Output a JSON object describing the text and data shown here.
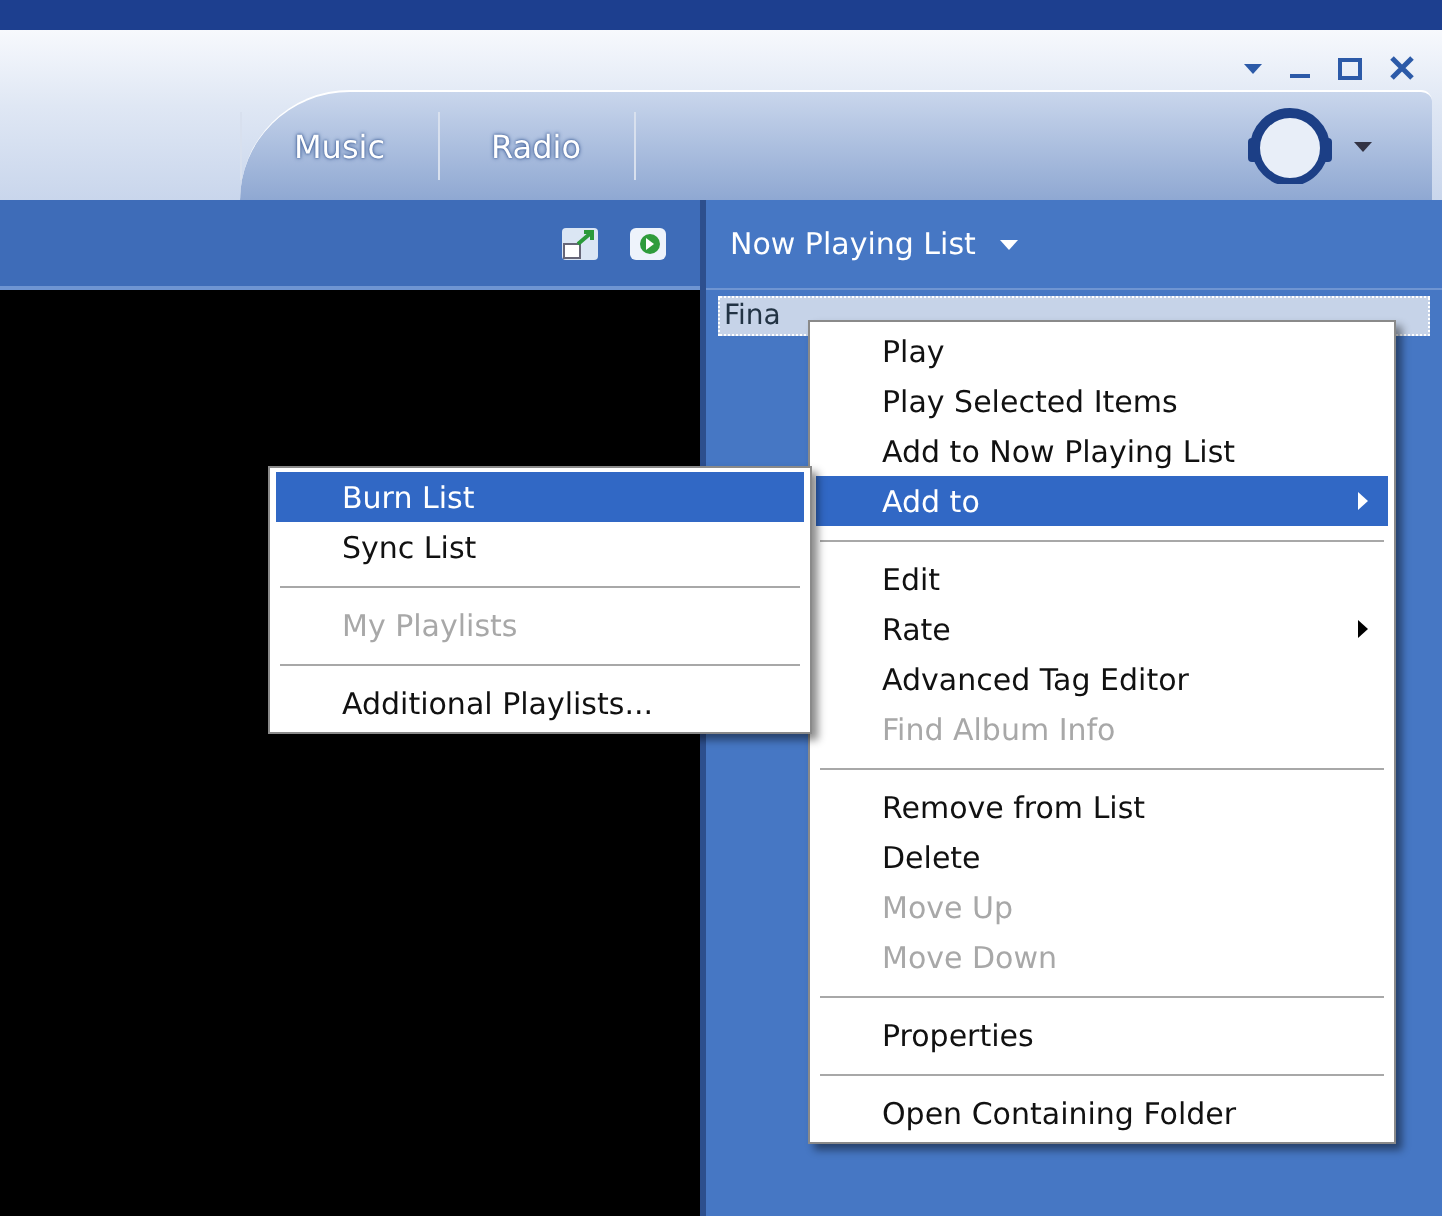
{
  "tabs": [
    {
      "label": "Music"
    },
    {
      "label": "Radio"
    }
  ],
  "now_playing": {
    "title": "Now Playing List",
    "rows": [
      {
        "title": "Fina"
      }
    ]
  },
  "context_menu": {
    "items": [
      {
        "kind": "item",
        "label": "Play",
        "disabled": false,
        "selected": false,
        "submenu": false
      },
      {
        "kind": "item",
        "label": "Play Selected Items",
        "disabled": false,
        "selected": false,
        "submenu": false
      },
      {
        "kind": "item",
        "label": "Add to Now Playing List",
        "disabled": false,
        "selected": false,
        "submenu": false
      },
      {
        "kind": "item",
        "label": "Add to",
        "disabled": false,
        "selected": true,
        "submenu": true
      },
      {
        "kind": "separator"
      },
      {
        "kind": "item",
        "label": "Edit",
        "disabled": false,
        "selected": false,
        "submenu": false
      },
      {
        "kind": "item",
        "label": "Rate",
        "disabled": false,
        "selected": false,
        "submenu": true
      },
      {
        "kind": "item",
        "label": "Advanced Tag Editor",
        "disabled": false,
        "selected": false,
        "submenu": false
      },
      {
        "kind": "item",
        "label": "Find Album Info",
        "disabled": true,
        "selected": false,
        "submenu": false
      },
      {
        "kind": "separator"
      },
      {
        "kind": "item",
        "label": "Remove from List",
        "disabled": false,
        "selected": false,
        "submenu": false
      },
      {
        "kind": "item",
        "label": "Delete",
        "disabled": false,
        "selected": false,
        "submenu": false
      },
      {
        "kind": "item",
        "label": "Move Up",
        "disabled": true,
        "selected": false,
        "submenu": false
      },
      {
        "kind": "item",
        "label": "Move Down",
        "disabled": true,
        "selected": false,
        "submenu": false
      },
      {
        "kind": "separator"
      },
      {
        "kind": "item",
        "label": "Properties",
        "disabled": false,
        "selected": false,
        "submenu": false
      },
      {
        "kind": "separator"
      },
      {
        "kind": "item",
        "label": "Open Containing Folder",
        "disabled": false,
        "selected": false,
        "submenu": false
      }
    ]
  },
  "submenu": {
    "items": [
      {
        "kind": "item",
        "label": "Burn List",
        "disabled": false,
        "selected": true,
        "submenu": false
      },
      {
        "kind": "item",
        "label": "Sync List",
        "disabled": false,
        "selected": false,
        "submenu": false
      },
      {
        "kind": "separator"
      },
      {
        "kind": "item",
        "label": "My Playlists",
        "disabled": true,
        "selected": false,
        "submenu": false
      },
      {
        "kind": "separator"
      },
      {
        "kind": "item",
        "label": "Additional Playlists...",
        "disabled": false,
        "selected": false,
        "submenu": false
      }
    ]
  }
}
